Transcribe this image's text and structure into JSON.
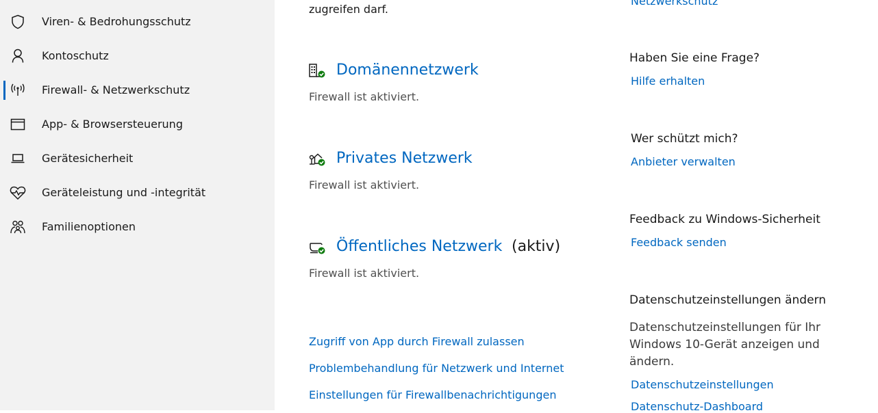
{
  "sidebar": {
    "items": [
      {
        "label": "Viren- & Bedrohungsschutz",
        "icon": "shield-icon"
      },
      {
        "label": "Kontoschutz",
        "icon": "person-icon"
      },
      {
        "label": "Firewall- & Netzwerkschutz",
        "icon": "wireless-icon",
        "selected": true
      },
      {
        "label": "App- & Browsersteuerung",
        "icon": "browser-window-icon"
      },
      {
        "label": "Gerätesicherheit",
        "icon": "laptop-icon"
      },
      {
        "label": "Geräteleistung und -integrität",
        "icon": "heart-pulse-icon"
      },
      {
        "label": "Familienoptionen",
        "icon": "family-icon"
      }
    ]
  },
  "main": {
    "intro_tail": "zugreifen darf.",
    "networks": [
      {
        "title": "Domänennetzwerk",
        "status": "Firewall ist aktiviert.",
        "icon": "domain-network-icon",
        "active_tag": ""
      },
      {
        "title": "Privates Netzwerk",
        "status": "Firewall ist aktiviert.",
        "icon": "private-network-icon",
        "active_tag": ""
      },
      {
        "title": "Öffentliches Netzwerk",
        "status": "Firewall ist aktiviert.",
        "icon": "public-network-icon",
        "active_tag": "(aktiv)"
      }
    ],
    "links": [
      "Zugriff von App durch Firewall zulassen",
      "Problembehandlung für Netzwerk und Internet",
      "Einstellungen für Firewallbenachrichtigungen"
    ]
  },
  "right": {
    "top_link": "Netzwerkschutz",
    "question": {
      "heading": "Haben Sie eine Frage?",
      "link": "Hilfe erhalten"
    },
    "who": {
      "heading": "Wer schützt mich?",
      "link": "Anbieter verwalten"
    },
    "feedback": {
      "heading": "Feedback zu Windows-Sicherheit",
      "link": "Feedback senden"
    },
    "privacy": {
      "heading": "Datenschutzeinstellungen ändern",
      "text": "Datenschutzeinstellungen für Ihr Windows 10-Gerät anzeigen und ändern.",
      "link1": "Datenschutzeinstellungen",
      "link2": "Datenschutz-Dashboard"
    }
  },
  "colors": {
    "accent": "#0067c0",
    "status_ok": "#107c10",
    "sidebar_bg": "#f2f2f2"
  }
}
